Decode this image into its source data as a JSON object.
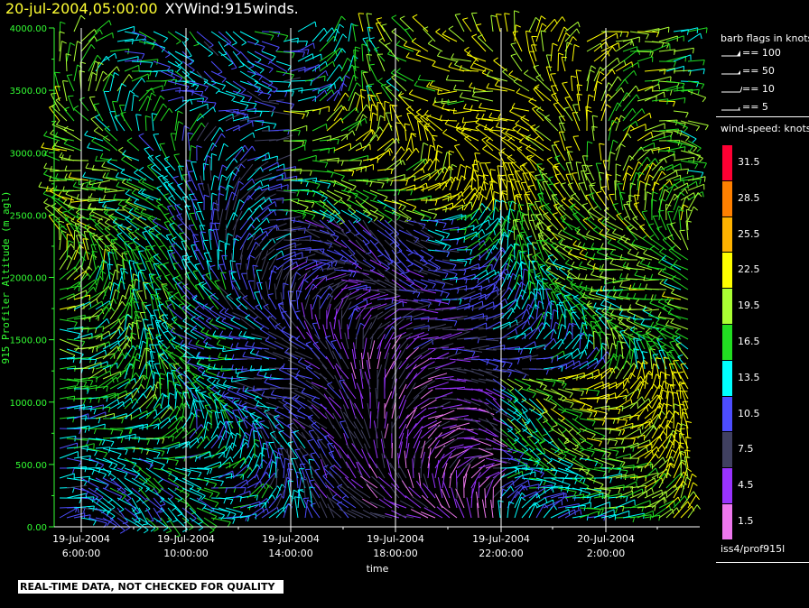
{
  "header": {
    "date": "20-jul-2004,05:00:00",
    "name": "XYWind:915winds."
  },
  "notice": "REAL-TIME DATA, NOT CHECKED FOR QUALITY",
  "legend": {
    "barb_title": "barb flags in knots",
    "barb_items": [
      "== 100",
      "== 50",
      "== 10",
      "== 5"
    ],
    "speed_title": "wind-speed: knots",
    "station": "iss4/prof915l"
  },
  "colors": {
    "background": "#000000",
    "axis": "#33ff33",
    "text": "#ffffff",
    "title_date": "#ffff33"
  },
  "chart_data": {
    "type": "scatter",
    "xlabel": "time",
    "ylabel": "915 Profiler Altitude (m agl)",
    "ylim": [
      0,
      4000
    ],
    "yticks": [
      "0.00",
      "500.00",
      "1000.00",
      "1500.00",
      "2000.00",
      "2500.00",
      "3000.00",
      "3500.00",
      "4000.00"
    ],
    "xticks": [
      {
        "date": "19-Jul-2004",
        "time": "6:00:00"
      },
      {
        "date": "19-Jul-2004",
        "time": "10:00:00"
      },
      {
        "date": "19-Jul-2004",
        "time": "14:00:00"
      },
      {
        "date": "19-Jul-2004",
        "time": "18:00:00"
      },
      {
        "date": "19-Jul-2004",
        "time": "22:00:00"
      },
      {
        "date": "20-Jul-2004",
        "time": "2:00:00"
      }
    ],
    "grid": "vertical lines at time ticks",
    "speed_scale": [
      {
        "value": "31.5",
        "color": "#ff0033"
      },
      {
        "value": "28.5",
        "color": "#ff8000"
      },
      {
        "value": "25.5",
        "color": "#ffb300"
      },
      {
        "value": "22.5",
        "color": "#ffff00"
      },
      {
        "value": "19.5",
        "color": "#aaff33"
      },
      {
        "value": "16.5",
        "color": "#22dd22"
      },
      {
        "value": "13.5",
        "color": "#00ffff"
      },
      {
        "value": "10.5",
        "color": "#4d4dff"
      },
      {
        "value": "7.5",
        "color": "#404060"
      },
      {
        "value": "4.5",
        "color": "#9933ff"
      },
      {
        "value": "1.5",
        "color": "#ee77ee"
      }
    ]
  }
}
